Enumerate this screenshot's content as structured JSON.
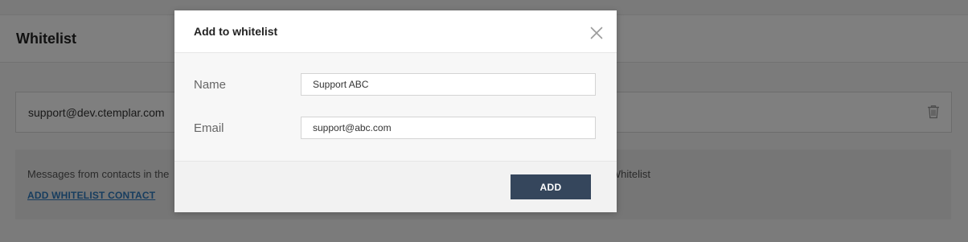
{
  "page": {
    "title": "Whitelist",
    "entries": [
      {
        "email": "support@dev.ctemplar.com"
      }
    ],
    "info": {
      "text_left": "Messages from contacts in the",
      "text_right": "e Whitelist",
      "add_link": "ADD WHITELIST CONTACT"
    }
  },
  "modal": {
    "title": "Add to whitelist",
    "fields": {
      "name_label": "Name",
      "name_value": "Support ABC",
      "email_label": "Email",
      "email_value": "support@abc.com"
    },
    "add_label": "ADD"
  },
  "colors": {
    "accent": "#35465c",
    "link": "#2f7bbf"
  },
  "icons": {
    "close": "close-icon",
    "delete": "trash-icon"
  }
}
